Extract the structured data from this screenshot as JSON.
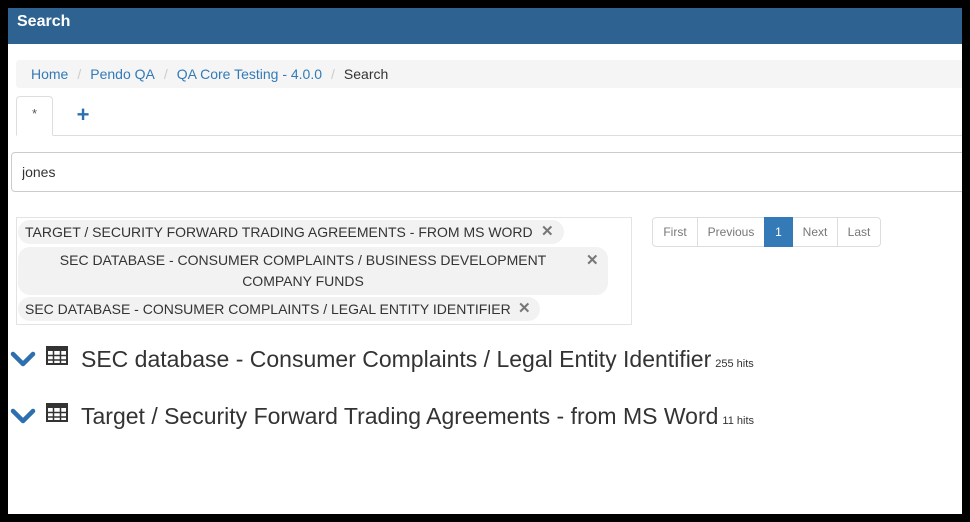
{
  "window": {
    "title": "Search"
  },
  "breadcrumb": {
    "items": [
      {
        "label": "Home"
      },
      {
        "label": "Pendo QA"
      },
      {
        "label": "QA Core Testing - 4.0.0"
      }
    ],
    "current": "Search",
    "separator": "/"
  },
  "tabs": {
    "active_label": "*",
    "add_label": "+"
  },
  "search": {
    "value": "jones"
  },
  "filters": [
    {
      "label": "TARGET / SECURITY FORWARD TRADING AGREEMENTS - FROM MS WORD",
      "remove": "✕"
    },
    {
      "label": "SEC DATABASE - CONSUMER COMPLAINTS / BUSINESS DEVELOPMENT COMPANY FUNDS",
      "remove": "✕"
    },
    {
      "label": "SEC DATABASE - CONSUMER COMPLAINTS / LEGAL ENTITY IDENTIFIER",
      "remove": "✕"
    }
  ],
  "pager": {
    "first": "First",
    "previous": "Previous",
    "current": "1",
    "next": "Next",
    "last": "Last"
  },
  "results": [
    {
      "title": "SEC database - Consumer Complaints / Legal Entity Identifier",
      "hits": "255 hits",
      "icon": "table-icon"
    },
    {
      "title": "Target / Security Forward Trading Agreements - from MS Word",
      "hits": "11 hits",
      "icon": "table-icon"
    }
  ],
  "colors": {
    "header": "#2e6391",
    "link": "#337ab7",
    "accent": "#2e6fb0",
    "active_page": "#337ab7"
  }
}
